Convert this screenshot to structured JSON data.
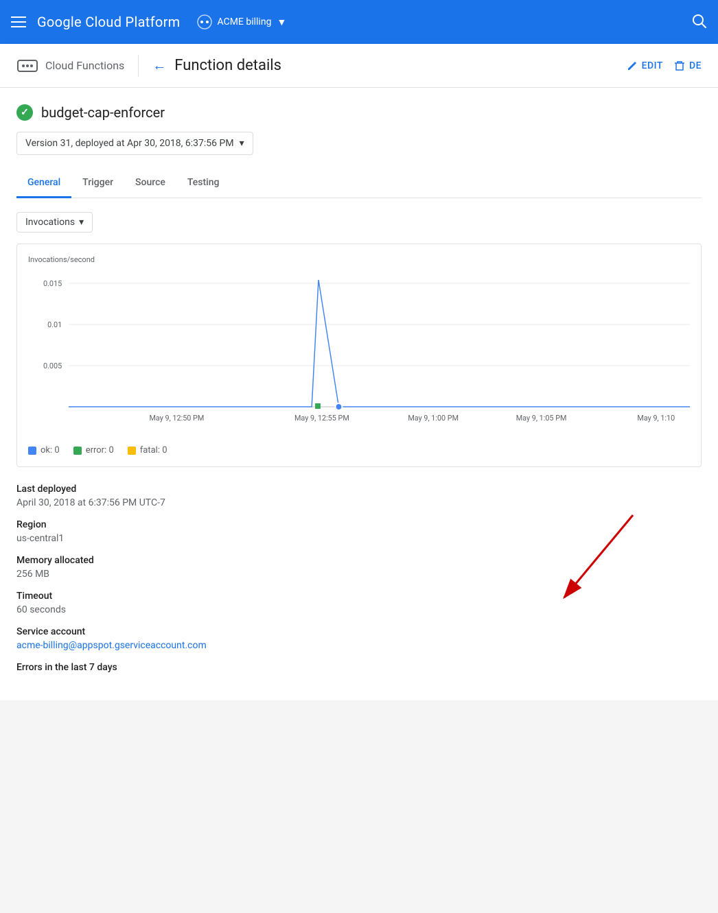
{
  "topNav": {
    "title": "Google Cloud Platform",
    "billing": "ACME billing",
    "chevron": "▼"
  },
  "subHeader": {
    "service": "Cloud Functions",
    "backArrow": "←",
    "pageTitle": "Function details",
    "editLabel": "EDIT",
    "deleteLabel": "DE"
  },
  "function": {
    "name": "budget-cap-enforcer",
    "version": "Version 31, deployed at Apr 30, 2018, 6:37:56 PM",
    "status": "ok"
  },
  "tabs": [
    {
      "label": "General",
      "active": true
    },
    {
      "label": "Trigger",
      "active": false
    },
    {
      "label": "Source",
      "active": false
    },
    {
      "label": "Testing",
      "active": false
    }
  ],
  "metricSelector": {
    "label": "Invocations",
    "chevron": "▾"
  },
  "chart": {
    "yAxisLabel": "Invocations/second",
    "yLabels": [
      "0.015",
      "0.01",
      "0.005"
    ],
    "xLabels": [
      "May 9, 12:50 PM",
      "May 9, 12:55 PM",
      "May 9, 1:00 PM",
      "May 9, 1:05 PM",
      "May 9, 1:10"
    ],
    "legend": [
      {
        "label": "ok: 0",
        "color": "#4285f4"
      },
      {
        "label": "error: 0",
        "color": "#34a853"
      },
      {
        "label": "fatal: 0",
        "color": "#fbbc04"
      }
    ]
  },
  "details": {
    "lastDeployedLabel": "Last deployed",
    "lastDeployedValue": "April 30, 2018 at 6:37:56 PM UTC-7",
    "regionLabel": "Region",
    "regionValue": "us-central1",
    "memoryLabel": "Memory allocated",
    "memoryValue": "256 MB",
    "timeoutLabel": "Timeout",
    "timeoutValue": "60 seconds",
    "serviceAccountLabel": "Service account",
    "serviceAccountValue": "acme-billing@appspot.gserviceaccount.com",
    "errorsLabel": "Errors in the last 7 days"
  }
}
